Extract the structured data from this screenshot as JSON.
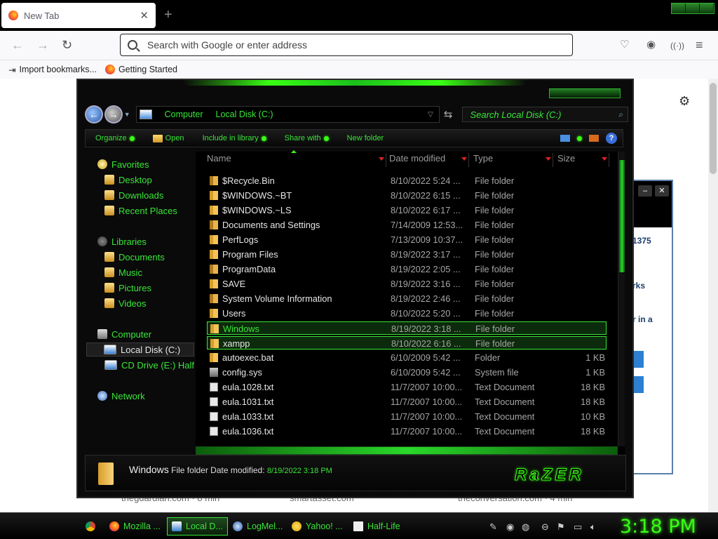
{
  "browser": {
    "tab_title": "New Tab",
    "tab_close": "✕",
    "new_tab": "+",
    "url_placeholder": "Search with Google or enter address",
    "bookmarks": [
      "Import bookmarks...",
      "Getting Started"
    ]
  },
  "background_window": {
    "text1": "1375",
    "text2": "rks",
    "text3": "r in a"
  },
  "background_articles": [
    "theguardian.com · 8 min",
    "smartasset.com",
    "theconversation.com · 4 min"
  ],
  "explorer": {
    "address_crumbs": [
      "Computer",
      "Local Disk (C:)"
    ],
    "search_placeholder": "Search Local Disk (C:)",
    "toolbar": {
      "organize": "Organize",
      "open": "Open",
      "include_in_library": "Include in library",
      "share_with": "Share with",
      "new_folder": "New folder"
    },
    "nav": {
      "favorites": "Favorites",
      "desktop": "Desktop",
      "downloads": "Downloads",
      "recent_places": "Recent Places",
      "libraries": "Libraries",
      "documents": "Documents",
      "music": "Music",
      "pictures": "Pictures",
      "videos": "Videos",
      "computer": "Computer",
      "local_disk": "Local Disk (C:)",
      "cd_drive": "CD Drive (E:) Half-",
      "network": "Network"
    },
    "columns": [
      "Name",
      "Date modified",
      "Type",
      "Size"
    ],
    "files": [
      {
        "name": "$Recycle.Bin",
        "date": "8/10/2022 5:24 ...",
        "type": "File folder",
        "size": "",
        "icon": "lock"
      },
      {
        "name": "$WINDOWS.~BT",
        "date": "8/10/2022 6:15 ...",
        "type": "File folder",
        "size": "",
        "icon": "folder"
      },
      {
        "name": "$WINDOWS.~LS",
        "date": "8/10/2022 6:17 ...",
        "type": "File folder",
        "size": "",
        "icon": "folder"
      },
      {
        "name": "Documents and Settings",
        "date": "7/14/2009 12:53...",
        "type": "File folder",
        "size": "",
        "icon": "lock"
      },
      {
        "name": "PerfLogs",
        "date": "7/13/2009 10:37...",
        "type": "File folder",
        "size": "",
        "icon": "folder"
      },
      {
        "name": "Program Files",
        "date": "8/19/2022 3:17 ...",
        "type": "File folder",
        "size": "",
        "icon": "folder"
      },
      {
        "name": "ProgramData",
        "date": "8/19/2022 2:05 ...",
        "type": "File folder",
        "size": "",
        "icon": "lock"
      },
      {
        "name": "SAVE",
        "date": "8/19/2022 3:16 ...",
        "type": "File folder",
        "size": "",
        "icon": "folder"
      },
      {
        "name": "System Volume Information",
        "date": "8/19/2022 2:46 ...",
        "type": "File folder",
        "size": "",
        "icon": "lock"
      },
      {
        "name": "Users",
        "date": "8/10/2022 5:20 ...",
        "type": "File folder",
        "size": "",
        "icon": "folder"
      },
      {
        "name": "Windows",
        "date": "8/19/2022 3:18 ...",
        "type": "File folder",
        "size": "",
        "icon": "folder"
      },
      {
        "name": "xampp",
        "date": "8/10/2022 6:16 ...",
        "type": "File folder",
        "size": "",
        "icon": "folder"
      },
      {
        "name": "autoexec.bat",
        "date": "6/10/2009 5:42 ...",
        "type": "Folder",
        "size": "1 KB",
        "icon": "folder"
      },
      {
        "name": "config.sys",
        "date": "6/10/2009 5:42 ...",
        "type": "System file",
        "size": "1 KB",
        "icon": "sys"
      },
      {
        "name": "eula.1028.txt",
        "date": "11/7/2007 10:00...",
        "type": "Text Document",
        "size": "18 KB",
        "icon": "file"
      },
      {
        "name": "eula.1031.txt",
        "date": "11/7/2007 10:00...",
        "type": "Text Document",
        "size": "18 KB",
        "icon": "file"
      },
      {
        "name": "eula.1033.txt",
        "date": "11/7/2007 10:00...",
        "type": "Text Document",
        "size": "10 KB",
        "icon": "file"
      },
      {
        "name": "eula.1036.txt",
        "date": "11/7/2007 10:00...",
        "type": "Text Document",
        "size": "18 KB",
        "icon": "file"
      }
    ],
    "details": {
      "name": "Windows",
      "type_label": "File folder",
      "date_label": "Date modified:",
      "date_value": "8/19/2022 3:18 PM"
    },
    "brand": "RaZER"
  },
  "taskbar": {
    "items": [
      "Mozilla ...",
      "Local D...",
      "LogMel...",
      "Yahoo! ...",
      "Half-Life"
    ],
    "clock": "3:18 PM"
  }
}
